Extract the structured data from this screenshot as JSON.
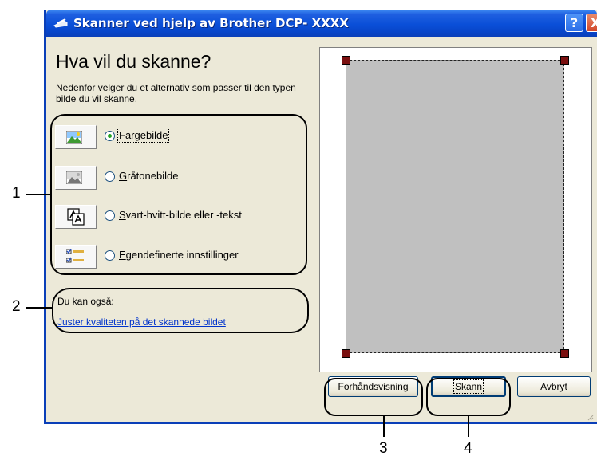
{
  "window": {
    "title": "Skanner ved hjelp av Brother DCP- XXXX",
    "help_label": "?",
    "close_label": "X"
  },
  "main": {
    "heading": "Hva vil du skanne?",
    "instructions": "Nedenfor velger du et alternativ som passer til den typen bilde du vil skanne.",
    "options": [
      {
        "mnemonic": "F",
        "rest": "argebilde",
        "icon": "color-picture-icon",
        "selected": true
      },
      {
        "mnemonic": "G",
        "rest": "råtonebilde",
        "icon": "grayscale-picture-icon",
        "selected": false
      },
      {
        "mnemonic": "S",
        "rest": "vart-hvitt-bilde eller -tekst",
        "icon": "black-white-text-icon",
        "selected": false
      },
      {
        "mnemonic": "E",
        "rest": "gendefinerte innstillinger",
        "icon": "custom-settings-icon",
        "selected": false
      }
    ],
    "also_label": "Du kan også:",
    "also_link": "Juster kvaliteten på det skannede bildet"
  },
  "buttons": {
    "preview_mnemonic": "F",
    "preview_rest": "orhåndsvisning",
    "scan_mnemonic": "S",
    "scan_rest": "kann",
    "cancel": "Avbryt"
  },
  "callouts": [
    "1",
    "2",
    "3",
    "4"
  ],
  "colors": {
    "titlebar": "#0a4fd8",
    "dialog_bg": "#ece9d8",
    "preview_bg": "#c0c0c0",
    "handle": "#7a0f0f",
    "link": "#0033cc"
  }
}
